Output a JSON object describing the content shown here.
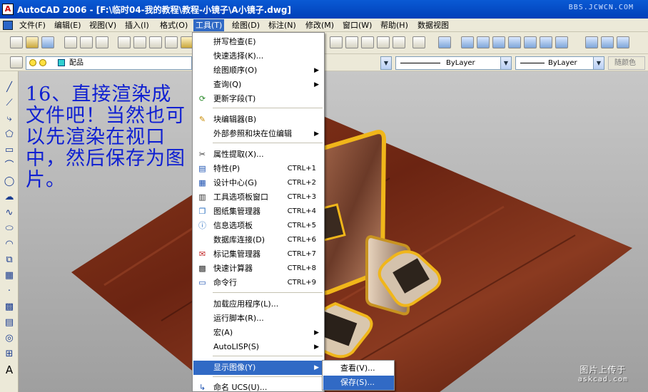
{
  "window": {
    "title": "AutoCAD 2006 - [F:\\临时04-我的教程\\教程-小镜子\\A小镜子.dwg]",
    "site_watermark": "BBS.JCWCN.COM"
  },
  "menubar": [
    {
      "id": "file",
      "label": "文件(F)"
    },
    {
      "id": "edit",
      "label": "编辑(E)"
    },
    {
      "id": "view",
      "label": "视图(V)"
    },
    {
      "id": "insert",
      "label": "插入(I)"
    },
    {
      "id": "format",
      "label": "格式(O)"
    },
    {
      "id": "tools",
      "label": "工具(T)"
    },
    {
      "id": "draw",
      "label": "绘图(D)"
    },
    {
      "id": "dimension",
      "label": "标注(N)"
    },
    {
      "id": "modify",
      "label": "修改(M)"
    },
    {
      "id": "window",
      "label": "窗口(W)"
    },
    {
      "id": "help",
      "label": "帮助(H)"
    },
    {
      "id": "dataview",
      "label": "数据视图"
    }
  ],
  "layer_toolbar": {
    "current_layer": "配品",
    "linetype": "ByLayer",
    "lineweight": "ByLayer",
    "color": "随颜色"
  },
  "instruction": "16、直接渲染成文件吧！当然也可以先渲染在视口中，然后保存为图片。",
  "tools_menu": [
    {
      "label": "拼写检查(E)",
      "icon": "",
      "shortcut": "",
      "sub": false
    },
    {
      "label": "快速选择(K)...",
      "icon": "",
      "shortcut": "",
      "sub": false
    },
    {
      "label": "绘图顺序(O)",
      "icon": "",
      "shortcut": "",
      "sub": true
    },
    {
      "label": "查询(Q)",
      "icon": "",
      "shortcut": "",
      "sub": true
    },
    {
      "label": "更新字段(T)",
      "icon": "update-field-icon",
      "shortcut": "",
      "sub": false
    },
    {
      "label": "块编辑器(B)",
      "icon": "block-editor-icon",
      "shortcut": "",
      "sub": false
    },
    {
      "label": "外部参照和块在位编辑",
      "icon": "",
      "shortcut": "",
      "sub": true
    },
    {
      "label": "属性提取(X)...",
      "icon": "attribute-extract-icon",
      "shortcut": "",
      "sub": false
    },
    {
      "label": "特性(P)",
      "icon": "properties-icon",
      "shortcut": "CTRL+1",
      "sub": false
    },
    {
      "label": "设计中心(G)",
      "icon": "design-center-icon",
      "shortcut": "CTRL+2",
      "sub": false
    },
    {
      "label": "工具选项板窗口",
      "icon": "tool-palettes-icon",
      "shortcut": "CTRL+3",
      "sub": false
    },
    {
      "label": "图纸集管理器",
      "icon": "sheet-set-icon",
      "shortcut": "CTRL+4",
      "sub": false
    },
    {
      "label": "信息选项板",
      "icon": "info-palette-icon",
      "shortcut": "CTRL+5",
      "sub": false
    },
    {
      "label": "数据库连接(D)",
      "icon": "",
      "shortcut": "CTRL+6",
      "sub": false
    },
    {
      "label": "标记集管理器",
      "icon": "markup-set-icon",
      "shortcut": "CTRL+7",
      "sub": false
    },
    {
      "label": "快速计算器",
      "icon": "calculator-icon",
      "shortcut": "CTRL+8",
      "sub": false
    },
    {
      "label": "命令行",
      "icon": "command-line-icon",
      "shortcut": "CTRL+9",
      "sub": false
    },
    {
      "label": "加载应用程序(L)...",
      "icon": "",
      "shortcut": "",
      "sub": false
    },
    {
      "label": "运行脚本(R)...",
      "icon": "",
      "shortcut": "",
      "sub": false
    },
    {
      "label": "宏(A)",
      "icon": "",
      "shortcut": "",
      "sub": true
    },
    {
      "label": "AutoLISP(S)",
      "icon": "",
      "shortcut": "",
      "sub": true
    },
    {
      "label": "显示图像(Y)",
      "icon": "",
      "shortcut": "",
      "sub": true,
      "highlighted": true
    },
    {
      "label": "命名 UCS(U)...",
      "icon": "ucs-icon",
      "shortcut": "",
      "sub": false
    }
  ],
  "display_image_submenu": [
    {
      "label": "查看(V)..."
    },
    {
      "label": "保存(S)...",
      "highlighted": true
    }
  ],
  "watermark": {
    "text": "图片上传于",
    "site": "askcad.com"
  },
  "colors": {
    "titlebar": "#0a5ad4",
    "highlight": "#316ac5",
    "instruction_text": "#0f20d2",
    "menubar_bg": "#ece9d8",
    "frame_gold": "#f0b61a",
    "wood": "#7a2a16"
  }
}
